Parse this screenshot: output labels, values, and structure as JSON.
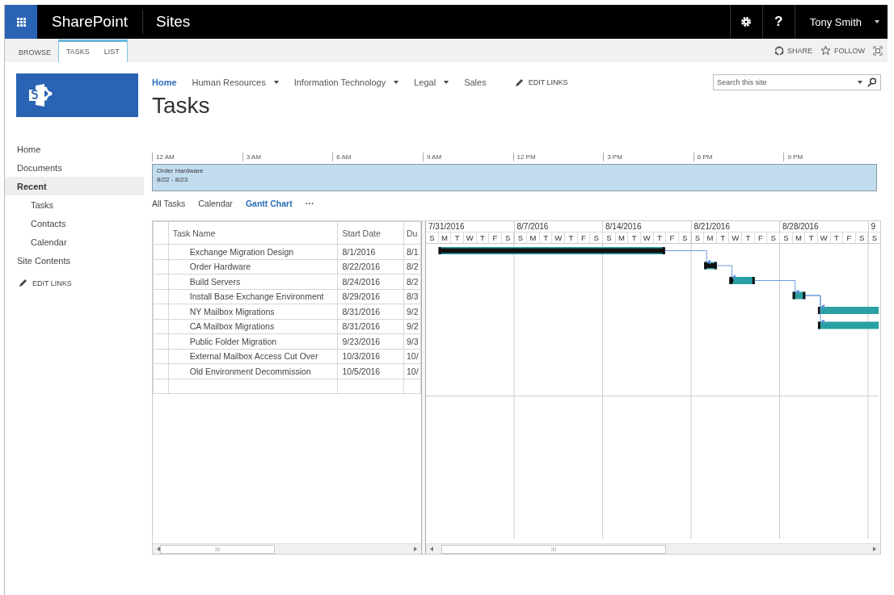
{
  "suite_bar": {
    "app_name": "SharePoint",
    "section": "Sites",
    "help": "?",
    "user": "Tony Smith"
  },
  "ribbon": {
    "tabs": [
      {
        "label": "BROWSE",
        "kind": "standard"
      },
      {
        "label": "TASKS",
        "kind": "contextual"
      },
      {
        "label": "LIST",
        "kind": "contextual"
      }
    ],
    "actions": [
      {
        "label": "SHARE",
        "kind": "share"
      },
      {
        "label": "FOLLOW",
        "kind": "follow"
      }
    ]
  },
  "top_nav": {
    "items": [
      {
        "label": "Home",
        "selected": true,
        "dropdown": false
      },
      {
        "label": "Human Resources",
        "selected": false,
        "dropdown": true
      },
      {
        "label": "Information Technology",
        "selected": false,
        "dropdown": true
      },
      {
        "label": "Legal",
        "selected": false,
        "dropdown": true
      },
      {
        "label": "Sales",
        "selected": false,
        "dropdown": false
      }
    ],
    "edit_links": "EDIT LINKS"
  },
  "search": {
    "placeholder": "Search this site"
  },
  "page_title": "Tasks",
  "left_nav": {
    "items": [
      {
        "label": "Home",
        "selected": false
      },
      {
        "label": "Documents",
        "selected": false
      },
      {
        "label": "Recent",
        "selected": true,
        "children": [
          {
            "label": "Tasks",
            "selected": false
          },
          {
            "label": "Contacts",
            "selected": false
          },
          {
            "label": "Calendar",
            "selected": false
          }
        ]
      },
      {
        "label": "Site Contents",
        "selected": false
      }
    ],
    "edit_links": "EDIT LINKS"
  },
  "timeline": {
    "ticks": [
      "12 AM",
      "3 AM",
      "6 AM",
      "9 AM",
      "12 PM",
      "3 PM",
      "6 PM",
      "9 PM"
    ],
    "task": {
      "name": "Order Hardware",
      "dates": "8/22 - 8/23"
    }
  },
  "views": [
    {
      "label": "All Tasks",
      "selected": false
    },
    {
      "label": "Calendar",
      "selected": false
    },
    {
      "label": "Gantt Chart",
      "selected": true
    }
  ],
  "views_more": "···",
  "grid": {
    "columns": [
      "Task Name",
      "Start Date",
      "Du"
    ],
    "rows": [
      {
        "task_name": "Exchange Migration Design",
        "start_date": "8/1/2016",
        "column_3": "8/1"
      },
      {
        "task_name": "Order Hardware",
        "start_date": "8/22/2016",
        "column_3": "8/2"
      },
      {
        "task_name": "Build Servers",
        "start_date": "8/24/2016",
        "column_3": "8/2"
      },
      {
        "task_name": "Install Base Exchange Environment",
        "start_date": "8/29/2016",
        "column_3": "8/3"
      },
      {
        "task_name": "NY Mailbox Migrations",
        "start_date": "8/31/2016",
        "column_3": "9/2"
      },
      {
        "task_name": "CA Mailbox Migrations",
        "start_date": "8/31/2016",
        "column_3": "9/2"
      },
      {
        "task_name": "Public Folder Migration",
        "start_date": "9/23/2016",
        "column_3": "9/3"
      },
      {
        "task_name": "External Mailbox Access Cut Over",
        "start_date": "10/3/2016",
        "column_3": "10/"
      },
      {
        "task_name": "Old Environment Decommission",
        "start_date": "10/5/2016",
        "column_3": "10/"
      }
    ]
  },
  "gantt": {
    "weeks": [
      {
        "label": "7/31/2016",
        "days": [
          "S",
          "M",
          "T",
          "W",
          "T",
          "F",
          "S"
        ]
      },
      {
        "label": "8/7/2016",
        "days": [
          "S",
          "M",
          "T",
          "W",
          "T",
          "F",
          "S"
        ]
      },
      {
        "label": "8/14/2016",
        "days": [
          "S",
          "M",
          "T",
          "W",
          "T",
          "F",
          "S"
        ]
      },
      {
        "label": "8/21/2016",
        "days": [
          "S",
          "M",
          "T",
          "W",
          "T",
          "F",
          "S"
        ]
      },
      {
        "label": "8/28/2016",
        "days": [
          "S",
          "M",
          "T",
          "W",
          "T",
          "F",
          "S"
        ]
      },
      {
        "label": "9",
        "days": [
          "S"
        ]
      }
    ]
  }
}
